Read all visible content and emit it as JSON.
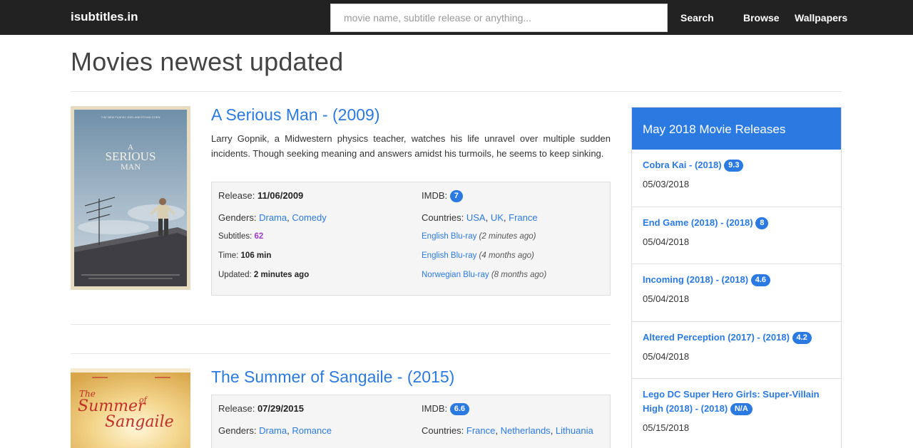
{
  "navbar": {
    "brand": "isubtitles.in",
    "search_placeholder": "movie name, subtitle release or anything...",
    "search_label": "Search",
    "browse_label": "Browse",
    "wallpapers_label": "Wallpapers"
  },
  "page_title": "Movies newest updated",
  "movies": [
    {
      "title": "A Serious Man - (2009)",
      "description": "Larry Gopnik, a Midwestern physics teacher, watches his life unravel over multiple sudden incidents. Though seeking meaning and answers amidst his turmoils, he seems to keep sinking.",
      "release_label": "Release:",
      "release": "11/06/2009",
      "imdb_label": "IMDB:",
      "imdb": "7",
      "genres_label": "Genders:",
      "genres": [
        "Drama",
        "Comedy"
      ],
      "countries_label": "Countries:",
      "countries": [
        "USA",
        "UK",
        "France"
      ],
      "subtitles_label": "Subtitles:",
      "subtitles": "62",
      "time_label": "Time:",
      "time": "106 min",
      "updated_label": "Updated:",
      "updated": "2 minutes ago",
      "recent_subs": [
        {
          "name": "English Blu-ray",
          "ago": "(2 minutes ago)"
        },
        {
          "name": "English Blu-ray",
          "ago": "(4 months ago)"
        },
        {
          "name": "Norwegian Blu-ray",
          "ago": "(8 months ago)"
        }
      ],
      "poster_text": {
        "top": "THE NEW FILM BY JOEL AND ETHAN COEN",
        "l1": "A",
        "l2": "SERIOUS",
        "l3": "MAN"
      }
    },
    {
      "title": "The Summer of Sangaile - (2015)",
      "release_label": "Release:",
      "release": "07/29/2015",
      "imdb_label": "IMDB:",
      "imdb": "6.6",
      "genres_label": "Genders:",
      "genres": [
        "Drama",
        "Romance"
      ],
      "countries_label": "Countries:",
      "countries": [
        "France",
        "Netherlands",
        "Lithuania"
      ],
      "poster_text": {
        "l1": "The",
        "l2": "Summer",
        "l3": "of",
        "l4": "Sangaile"
      }
    }
  ],
  "sidebar": {
    "header": "May 2018 Movie Releases",
    "items": [
      {
        "title": "Cobra Kai  - (2018)",
        "rating": "9.3",
        "date": "05/03/2018"
      },
      {
        "title": "End Game (2018) - (2018)",
        "rating": "8",
        "date": "05/04/2018"
      },
      {
        "title": "Incoming (2018) - (2018)",
        "rating": "4.6",
        "date": "05/04/2018"
      },
      {
        "title": "Altered Perception (2017) - (2018)",
        "rating": "4.2",
        "date": "05/04/2018"
      },
      {
        "title": "Lego DC Super Hero Girls: Super-Villain High (2018) - (2018)",
        "rating": "N/A",
        "date": "05/15/2018"
      }
    ]
  },
  "colors": {
    "navbar": "#222222",
    "link": "#2a7ae2",
    "subtitle_count": "#9b3dc8"
  }
}
